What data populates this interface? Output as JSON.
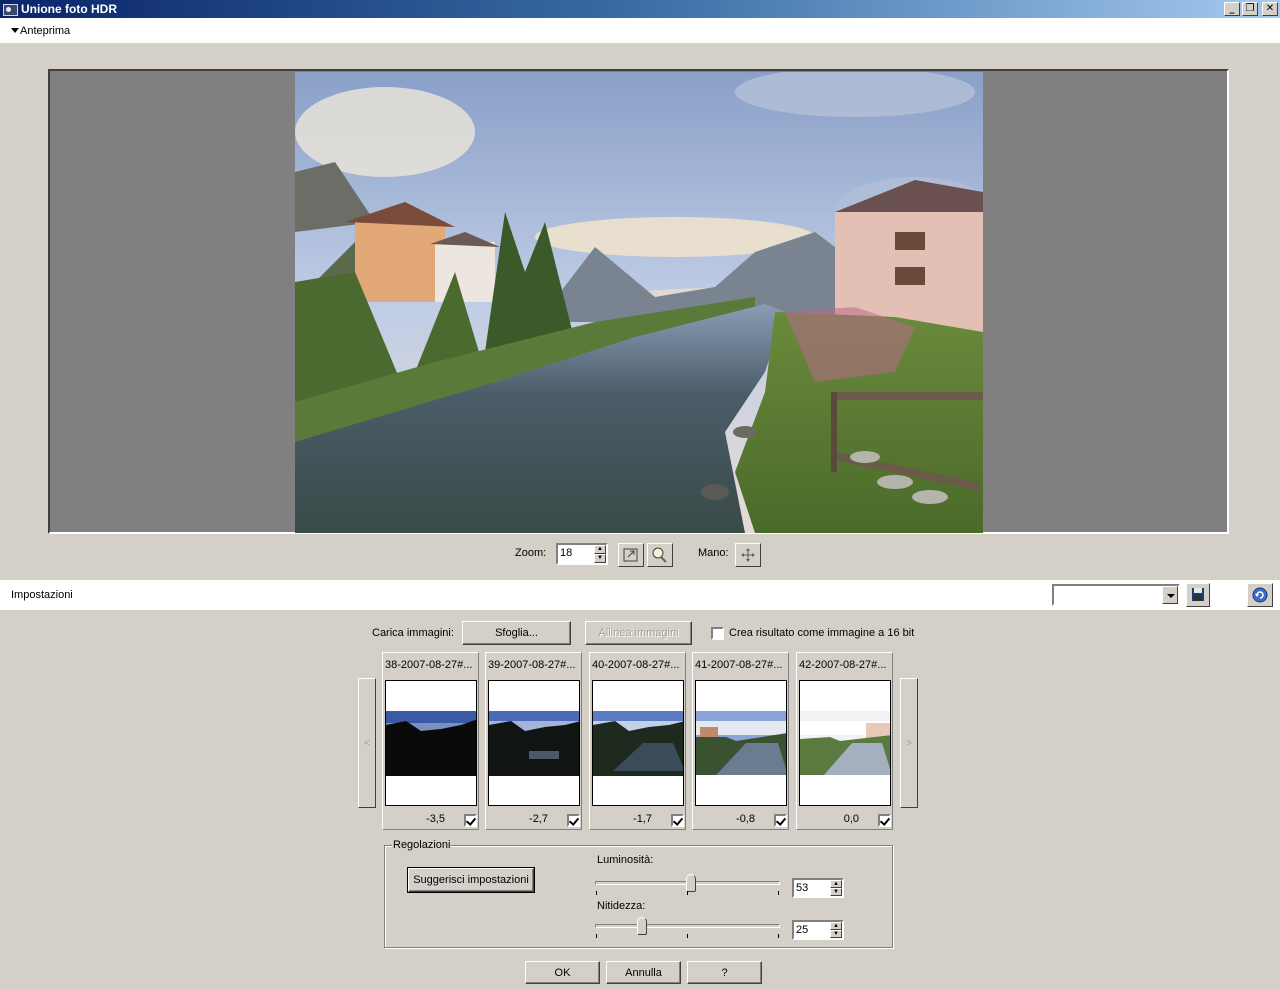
{
  "window": {
    "title": "Unione foto HDR"
  },
  "preview": {
    "section_label": "Anteprima"
  },
  "zoom": {
    "label": "Zoom:",
    "value": "18",
    "hand_label": "Mano:"
  },
  "settings": {
    "section_label": "Impostazioni"
  },
  "load": {
    "label": "Carica immagini:",
    "browse_label": "Sfoglia...",
    "align_label": "Allinea immagini",
    "create16_label": "Crea risultato come immagine a 16 bit"
  },
  "thumbnails": [
    {
      "name": "38-2007-08-27#...",
      "ev": "-3,5",
      "checked": true
    },
    {
      "name": "39-2007-08-27#...",
      "ev": "-2,7",
      "checked": true
    },
    {
      "name": "40-2007-08-27#...",
      "ev": "-1,7",
      "checked": true
    },
    {
      "name": "41-2007-08-27#...",
      "ev": "-0,8",
      "checked": true
    },
    {
      "name": "42-2007-08-27#...",
      "ev": "0,0",
      "checked": true
    }
  ],
  "nav": {
    "prev": "<",
    "next": ">"
  },
  "adjust": {
    "group_label": "Regolazioni",
    "suggest_label": "Suggerisci impostazioni",
    "brightness_label": "Luminosità:",
    "brightness_value": "53",
    "sharpness_label": "Nitidezza:",
    "sharpness_value": "25"
  },
  "footer": {
    "ok": "OK",
    "cancel": "Annulla",
    "help": "?"
  },
  "icons": {
    "app": "hdr-app-icon",
    "minimize": "minimize-icon",
    "restore": "restore-icon",
    "close": "close-icon",
    "fit": "fit-to-window-icon",
    "zoom": "zoom-magnifier-icon",
    "hand": "hand-pan-icon",
    "save": "floppy-save-icon",
    "reset": "reset-arrow-icon"
  },
  "colors": {
    "titlebar_start": "#0a246a",
    "titlebar_end": "#a6caf0",
    "face": "#d4d0c8",
    "preview_bg": "#808080"
  }
}
